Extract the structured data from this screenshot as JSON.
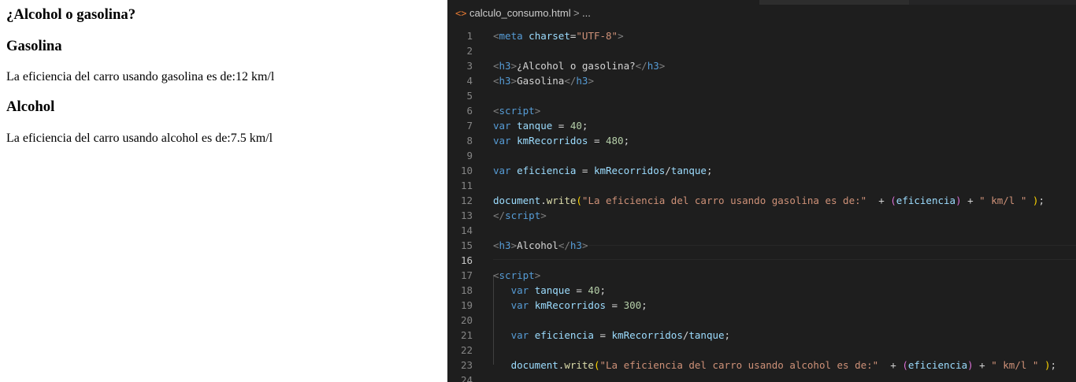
{
  "browser": {
    "h_title": "¿Alcohol o gasolina?",
    "h_gas": "Gasolina",
    "p_gas": "La eficiencia del carro usando gasolina es de:12 km/l",
    "h_alc": "Alcohol",
    "p_alc": "La eficiencia del carro usando alcohol es de:7.5 km/l"
  },
  "editor": {
    "breadcrumb": {
      "icon": "html-file-icon",
      "filename": "calculo_consumo.html",
      "separator": ">",
      "more": "..."
    },
    "active_line": "16",
    "lines": [
      {
        "n": "1",
        "tokens": [
          [
            "br",
            "<"
          ],
          [
            "tag",
            "meta"
          ],
          [
            "txt",
            " "
          ],
          [
            "attr",
            "charset"
          ],
          [
            "txt",
            "="
          ],
          [
            "str",
            "\"UTF-8\""
          ],
          [
            "br",
            ">"
          ]
        ]
      },
      {
        "n": "2",
        "tokens": []
      },
      {
        "n": "3",
        "tokens": [
          [
            "br",
            "<"
          ],
          [
            "tag",
            "h3"
          ],
          [
            "br",
            ">"
          ],
          [
            "txt",
            "¿Alcohol o gasolina?"
          ],
          [
            "br",
            "</"
          ],
          [
            "tag",
            "h3"
          ],
          [
            "br",
            ">"
          ]
        ]
      },
      {
        "n": "4",
        "tokens": [
          [
            "br",
            "<"
          ],
          [
            "tag",
            "h3"
          ],
          [
            "br",
            ">"
          ],
          [
            "txt",
            "Gasolina"
          ],
          [
            "br",
            "</"
          ],
          [
            "tag",
            "h3"
          ],
          [
            "br",
            ">"
          ]
        ]
      },
      {
        "n": "5",
        "tokens": []
      },
      {
        "n": "6",
        "tokens": [
          [
            "br",
            "<"
          ],
          [
            "tag",
            "script"
          ],
          [
            "br",
            ">"
          ]
        ]
      },
      {
        "n": "7",
        "tokens": [
          [
            "kw",
            "var"
          ],
          [
            "txt",
            " "
          ],
          [
            "var",
            "tanque"
          ],
          [
            "txt",
            " = "
          ],
          [
            "num",
            "40"
          ],
          [
            "txt",
            ";"
          ]
        ]
      },
      {
        "n": "8",
        "tokens": [
          [
            "kw",
            "var"
          ],
          [
            "txt",
            " "
          ],
          [
            "var",
            "kmRecorridos"
          ],
          [
            "txt",
            " = "
          ],
          [
            "num",
            "480"
          ],
          [
            "txt",
            ";"
          ]
        ]
      },
      {
        "n": "9",
        "tokens": []
      },
      {
        "n": "10",
        "tokens": [
          [
            "kw",
            "var"
          ],
          [
            "txt",
            " "
          ],
          [
            "var",
            "eficiencia"
          ],
          [
            "txt",
            " = "
          ],
          [
            "var",
            "kmRecorridos"
          ],
          [
            "txt",
            "/"
          ],
          [
            "var",
            "tanque"
          ],
          [
            "txt",
            ";"
          ]
        ]
      },
      {
        "n": "11",
        "tokens": []
      },
      {
        "n": "12",
        "tokens": [
          [
            "var",
            "document"
          ],
          [
            "txt",
            "."
          ],
          [
            "fn",
            "write"
          ],
          [
            "b1",
            "("
          ],
          [
            "str",
            "\"La eficiencia del carro usando gasolina es de:\""
          ],
          [
            "txt",
            "  + "
          ],
          [
            "b2",
            "("
          ],
          [
            "var",
            "eficiencia"
          ],
          [
            "b2",
            ")"
          ],
          [
            "txt",
            " + "
          ],
          [
            "str",
            "\" km/l \""
          ],
          [
            "txt",
            " "
          ],
          [
            "b1",
            ")"
          ],
          [
            "txt",
            ";"
          ]
        ]
      },
      {
        "n": "13",
        "tokens": [
          [
            "br",
            "</"
          ],
          [
            "tag",
            "script"
          ],
          [
            "br",
            ">"
          ]
        ]
      },
      {
        "n": "14",
        "tokens": []
      },
      {
        "n": "15",
        "tokens": [
          [
            "br",
            "<"
          ],
          [
            "tag",
            "h3"
          ],
          [
            "br",
            ">"
          ],
          [
            "txt",
            "Alcohol"
          ],
          [
            "br",
            "</"
          ],
          [
            "tag",
            "h3"
          ],
          [
            "br",
            ">"
          ]
        ]
      },
      {
        "n": "16",
        "tokens": []
      },
      {
        "n": "17",
        "tokens": [
          [
            "br",
            "<"
          ],
          [
            "tag",
            "script"
          ],
          [
            "br",
            ">"
          ]
        ]
      },
      {
        "n": "18",
        "tokens": [
          [
            "txt",
            "   "
          ],
          [
            "kw",
            "var"
          ],
          [
            "txt",
            " "
          ],
          [
            "var",
            "tanque"
          ],
          [
            "txt",
            " = "
          ],
          [
            "num",
            "40"
          ],
          [
            "txt",
            ";"
          ]
        ]
      },
      {
        "n": "19",
        "tokens": [
          [
            "txt",
            "   "
          ],
          [
            "kw",
            "var"
          ],
          [
            "txt",
            " "
          ],
          [
            "var",
            "kmRecorridos"
          ],
          [
            "txt",
            " = "
          ],
          [
            "num",
            "300"
          ],
          [
            "txt",
            ";"
          ]
        ]
      },
      {
        "n": "20",
        "tokens": []
      },
      {
        "n": "21",
        "tokens": [
          [
            "txt",
            "   "
          ],
          [
            "kw",
            "var"
          ],
          [
            "txt",
            " "
          ],
          [
            "var",
            "eficiencia"
          ],
          [
            "txt",
            " = "
          ],
          [
            "var",
            "kmRecorridos"
          ],
          [
            "txt",
            "/"
          ],
          [
            "var",
            "tanque"
          ],
          [
            "txt",
            ";"
          ]
        ]
      },
      {
        "n": "22",
        "tokens": []
      },
      {
        "n": "23",
        "tokens": [
          [
            "txt",
            "   "
          ],
          [
            "var",
            "document"
          ],
          [
            "txt",
            "."
          ],
          [
            "fn",
            "write"
          ],
          [
            "b1",
            "("
          ],
          [
            "str",
            "\"La eficiencia del carro usando alcohol es de:\""
          ],
          [
            "txt",
            "  + "
          ],
          [
            "b2",
            "("
          ],
          [
            "var",
            "eficiencia"
          ],
          [
            "b2",
            ")"
          ],
          [
            "txt",
            " + "
          ],
          [
            "str",
            "\" km/l \""
          ],
          [
            "txt",
            " "
          ],
          [
            "b1",
            ")"
          ],
          [
            "txt",
            ";"
          ]
        ]
      },
      {
        "n": "24",
        "tokens": []
      }
    ]
  }
}
